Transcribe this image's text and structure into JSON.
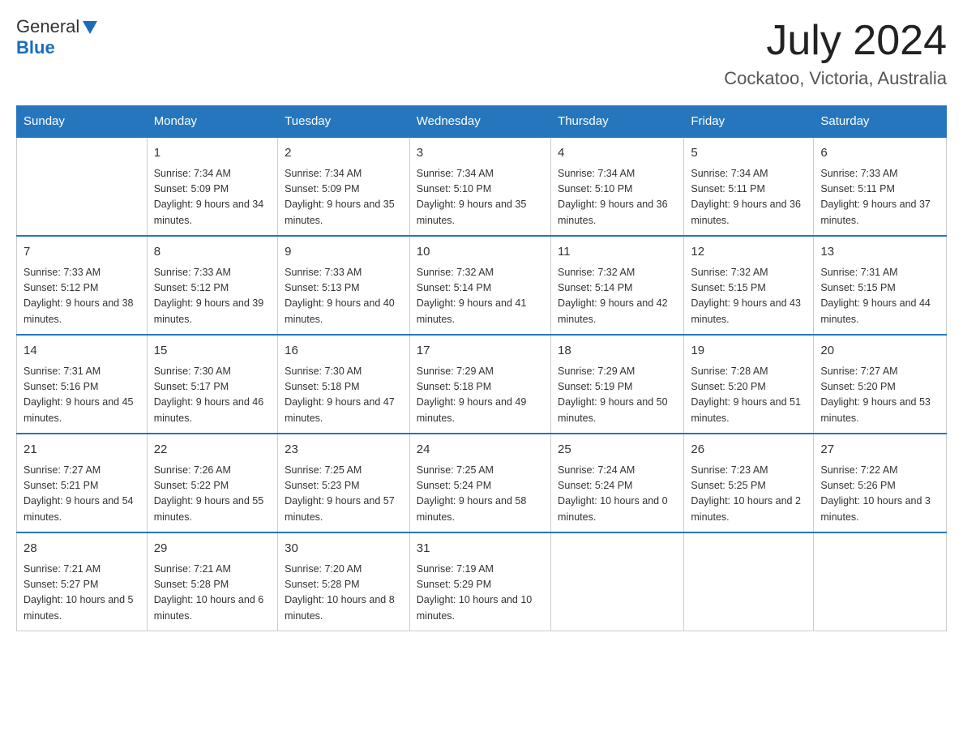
{
  "header": {
    "logo_general": "General",
    "logo_blue": "Blue",
    "month": "July 2024",
    "location": "Cockatoo, Victoria, Australia"
  },
  "days_of_week": [
    "Sunday",
    "Monday",
    "Tuesday",
    "Wednesday",
    "Thursday",
    "Friday",
    "Saturday"
  ],
  "weeks": [
    [
      {
        "day": "",
        "sunrise": "",
        "sunset": "",
        "daylight": ""
      },
      {
        "day": "1",
        "sunrise": "Sunrise: 7:34 AM",
        "sunset": "Sunset: 5:09 PM",
        "daylight": "Daylight: 9 hours and 34 minutes."
      },
      {
        "day": "2",
        "sunrise": "Sunrise: 7:34 AM",
        "sunset": "Sunset: 5:09 PM",
        "daylight": "Daylight: 9 hours and 35 minutes."
      },
      {
        "day": "3",
        "sunrise": "Sunrise: 7:34 AM",
        "sunset": "Sunset: 5:10 PM",
        "daylight": "Daylight: 9 hours and 35 minutes."
      },
      {
        "day": "4",
        "sunrise": "Sunrise: 7:34 AM",
        "sunset": "Sunset: 5:10 PM",
        "daylight": "Daylight: 9 hours and 36 minutes."
      },
      {
        "day": "5",
        "sunrise": "Sunrise: 7:34 AM",
        "sunset": "Sunset: 5:11 PM",
        "daylight": "Daylight: 9 hours and 36 minutes."
      },
      {
        "day": "6",
        "sunrise": "Sunrise: 7:33 AM",
        "sunset": "Sunset: 5:11 PM",
        "daylight": "Daylight: 9 hours and 37 minutes."
      }
    ],
    [
      {
        "day": "7",
        "sunrise": "Sunrise: 7:33 AM",
        "sunset": "Sunset: 5:12 PM",
        "daylight": "Daylight: 9 hours and 38 minutes."
      },
      {
        "day": "8",
        "sunrise": "Sunrise: 7:33 AM",
        "sunset": "Sunset: 5:12 PM",
        "daylight": "Daylight: 9 hours and 39 minutes."
      },
      {
        "day": "9",
        "sunrise": "Sunrise: 7:33 AM",
        "sunset": "Sunset: 5:13 PM",
        "daylight": "Daylight: 9 hours and 40 minutes."
      },
      {
        "day": "10",
        "sunrise": "Sunrise: 7:32 AM",
        "sunset": "Sunset: 5:14 PM",
        "daylight": "Daylight: 9 hours and 41 minutes."
      },
      {
        "day": "11",
        "sunrise": "Sunrise: 7:32 AM",
        "sunset": "Sunset: 5:14 PM",
        "daylight": "Daylight: 9 hours and 42 minutes."
      },
      {
        "day": "12",
        "sunrise": "Sunrise: 7:32 AM",
        "sunset": "Sunset: 5:15 PM",
        "daylight": "Daylight: 9 hours and 43 minutes."
      },
      {
        "day": "13",
        "sunrise": "Sunrise: 7:31 AM",
        "sunset": "Sunset: 5:15 PM",
        "daylight": "Daylight: 9 hours and 44 minutes."
      }
    ],
    [
      {
        "day": "14",
        "sunrise": "Sunrise: 7:31 AM",
        "sunset": "Sunset: 5:16 PM",
        "daylight": "Daylight: 9 hours and 45 minutes."
      },
      {
        "day": "15",
        "sunrise": "Sunrise: 7:30 AM",
        "sunset": "Sunset: 5:17 PM",
        "daylight": "Daylight: 9 hours and 46 minutes."
      },
      {
        "day": "16",
        "sunrise": "Sunrise: 7:30 AM",
        "sunset": "Sunset: 5:18 PM",
        "daylight": "Daylight: 9 hours and 47 minutes."
      },
      {
        "day": "17",
        "sunrise": "Sunrise: 7:29 AM",
        "sunset": "Sunset: 5:18 PM",
        "daylight": "Daylight: 9 hours and 49 minutes."
      },
      {
        "day": "18",
        "sunrise": "Sunrise: 7:29 AM",
        "sunset": "Sunset: 5:19 PM",
        "daylight": "Daylight: 9 hours and 50 minutes."
      },
      {
        "day": "19",
        "sunrise": "Sunrise: 7:28 AM",
        "sunset": "Sunset: 5:20 PM",
        "daylight": "Daylight: 9 hours and 51 minutes."
      },
      {
        "day": "20",
        "sunrise": "Sunrise: 7:27 AM",
        "sunset": "Sunset: 5:20 PM",
        "daylight": "Daylight: 9 hours and 53 minutes."
      }
    ],
    [
      {
        "day": "21",
        "sunrise": "Sunrise: 7:27 AM",
        "sunset": "Sunset: 5:21 PM",
        "daylight": "Daylight: 9 hours and 54 minutes."
      },
      {
        "day": "22",
        "sunrise": "Sunrise: 7:26 AM",
        "sunset": "Sunset: 5:22 PM",
        "daylight": "Daylight: 9 hours and 55 minutes."
      },
      {
        "day": "23",
        "sunrise": "Sunrise: 7:25 AM",
        "sunset": "Sunset: 5:23 PM",
        "daylight": "Daylight: 9 hours and 57 minutes."
      },
      {
        "day": "24",
        "sunrise": "Sunrise: 7:25 AM",
        "sunset": "Sunset: 5:24 PM",
        "daylight": "Daylight: 9 hours and 58 minutes."
      },
      {
        "day": "25",
        "sunrise": "Sunrise: 7:24 AM",
        "sunset": "Sunset: 5:24 PM",
        "daylight": "Daylight: 10 hours and 0 minutes."
      },
      {
        "day": "26",
        "sunrise": "Sunrise: 7:23 AM",
        "sunset": "Sunset: 5:25 PM",
        "daylight": "Daylight: 10 hours and 2 minutes."
      },
      {
        "day": "27",
        "sunrise": "Sunrise: 7:22 AM",
        "sunset": "Sunset: 5:26 PM",
        "daylight": "Daylight: 10 hours and 3 minutes."
      }
    ],
    [
      {
        "day": "28",
        "sunrise": "Sunrise: 7:21 AM",
        "sunset": "Sunset: 5:27 PM",
        "daylight": "Daylight: 10 hours and 5 minutes."
      },
      {
        "day": "29",
        "sunrise": "Sunrise: 7:21 AM",
        "sunset": "Sunset: 5:28 PM",
        "daylight": "Daylight: 10 hours and 6 minutes."
      },
      {
        "day": "30",
        "sunrise": "Sunrise: 7:20 AM",
        "sunset": "Sunset: 5:28 PM",
        "daylight": "Daylight: 10 hours and 8 minutes."
      },
      {
        "day": "31",
        "sunrise": "Sunrise: 7:19 AM",
        "sunset": "Sunset: 5:29 PM",
        "daylight": "Daylight: 10 hours and 10 minutes."
      },
      {
        "day": "",
        "sunrise": "",
        "sunset": "",
        "daylight": ""
      },
      {
        "day": "",
        "sunrise": "",
        "sunset": "",
        "daylight": ""
      },
      {
        "day": "",
        "sunrise": "",
        "sunset": "",
        "daylight": ""
      }
    ]
  ]
}
